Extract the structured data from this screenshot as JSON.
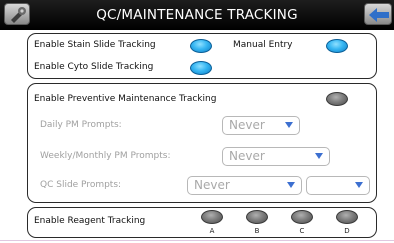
{
  "header": {
    "title": "QC/MAINTENANCE TRACKING",
    "left_icon": "settings-tools-icon",
    "right_icon": "back-arrow-icon"
  },
  "slide_tracking": {
    "stain_label": "Enable Stain Slide Tracking",
    "stain_state": "on",
    "manual_entry_label": "Manual Entry",
    "manual_entry_state": "on",
    "cyto_label": "Enable Cyto Slide Tracking",
    "cyto_state": "on"
  },
  "preventive_maintenance": {
    "enable_label": "Enable Preventive Maintenance Tracking",
    "enable_state": "off",
    "daily_label": "Daily PM Prompts:",
    "daily_value": "Never",
    "weekly_label": "Weekly/Monthly PM Prompts:",
    "weekly_value": "Never",
    "qc_label": "QC Slide Prompts:",
    "qc_value": "Never",
    "qc_second_value": ""
  },
  "reagent_tracking": {
    "label": "Enable Reagent Tracking",
    "toggles": [
      {
        "letter": "A",
        "state": "off"
      },
      {
        "letter": "B",
        "state": "off"
      },
      {
        "letter": "C",
        "state": "off"
      },
      {
        "letter": "D",
        "state": "off"
      }
    ]
  },
  "colors": {
    "toggle_on": "#36b6f2",
    "toggle_off": "#7e7e7e",
    "titlebar": "#000000",
    "dropdown_arrow": "#3c6fd0"
  }
}
